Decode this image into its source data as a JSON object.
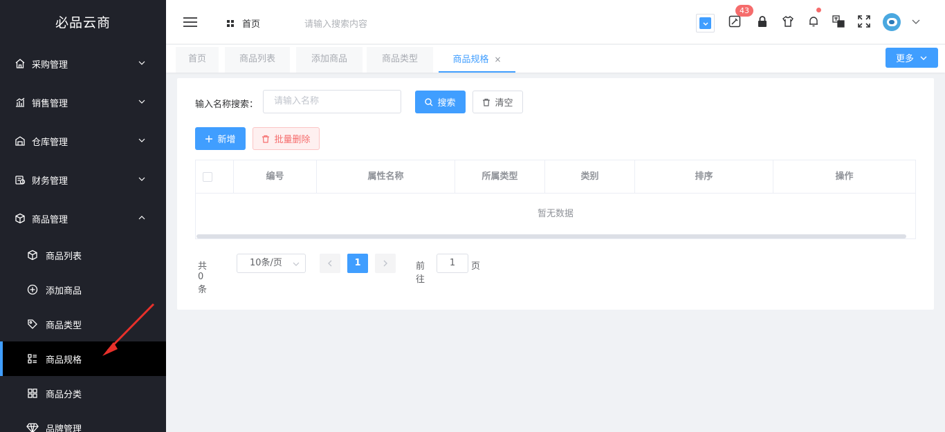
{
  "app": {
    "title": "必品云商"
  },
  "sidebar": {
    "menus": [
      {
        "label": "采购管理",
        "icon": "purchase-icon",
        "expanded": false
      },
      {
        "label": "销售管理",
        "icon": "sales-chart-icon",
        "expanded": false
      },
      {
        "label": "仓库管理",
        "icon": "warehouse-icon",
        "expanded": false
      },
      {
        "label": "财务管理",
        "icon": "finance-icon",
        "expanded": false
      },
      {
        "label": "商品管理",
        "icon": "box-icon",
        "expanded": true
      }
    ],
    "sub_items": [
      {
        "label": "商品列表",
        "icon": "cube-icon"
      },
      {
        "label": "添加商品",
        "icon": "plus-circle-icon"
      },
      {
        "label": "商品类型",
        "icon": "tag-icon"
      },
      {
        "label": "商品规格",
        "icon": "spec-list-icon",
        "active": true
      },
      {
        "label": "商品分类",
        "icon": "grid-icon"
      },
      {
        "label": "品牌管理",
        "icon": "diamond-icon"
      }
    ]
  },
  "header": {
    "home_label": "首页",
    "search_placeholder": "请输入搜索内容",
    "notification_count": "43"
  },
  "tabs": {
    "items": [
      {
        "label": "首页"
      },
      {
        "label": "商品列表"
      },
      {
        "label": "添加商品"
      },
      {
        "label": "商品类型"
      },
      {
        "label": "商品规格",
        "active": true,
        "close": "×"
      }
    ],
    "more_label": "更多"
  },
  "filter": {
    "label": "输入名称搜索：",
    "placeholder": "请输入名称",
    "search_label": "搜索",
    "clear_label": "清空"
  },
  "actions": {
    "add_label": "新增",
    "batch_delete_label": "批量删除"
  },
  "table": {
    "columns": [
      "编号",
      "属性名称",
      "所属类型",
      "类别",
      "排序",
      "操作"
    ],
    "empty_text": "暂无数据"
  },
  "pagination": {
    "total_text": "共 0 条",
    "page_size": "10条/页",
    "current_page": "1",
    "goto_label": "前往",
    "goto_value": "1",
    "page_unit": "页"
  },
  "colors": {
    "primary": "#409eff",
    "sidebar_bg": "#20222a",
    "danger": "#f56c6c",
    "annotation_arrow": "#e8302a"
  }
}
